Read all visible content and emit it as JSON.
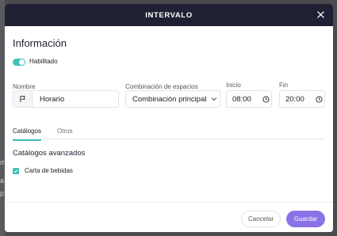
{
  "modal": {
    "title": "INTERVALO",
    "close_icon": "close-icon"
  },
  "info": {
    "title": "Información",
    "enabled_label": "Habilitado",
    "enabled": true
  },
  "fields": {
    "name": {
      "label": "Nombre",
      "value": "Horario",
      "icon": "flag-icon"
    },
    "combination": {
      "label": "Combinación de espacios",
      "value": "Combinación principal",
      "icon": "chevron-down-icon"
    },
    "start": {
      "label": "Inicio",
      "value": "08:00",
      "icon": "clock-icon"
    },
    "end": {
      "label": "Fin",
      "value": "20:00",
      "icon": "clock-icon"
    }
  },
  "tabs": [
    {
      "label": "Catálogos",
      "active": true
    },
    {
      "label": "Otros",
      "active": false
    }
  ],
  "catalogs": {
    "title": "Catálogos avanzados",
    "items": [
      {
        "label": "Carta de bebidas",
        "checked": true
      }
    ]
  },
  "footer": {
    "cancel_label": "Cancelar",
    "save_label": "Guardar"
  },
  "background": {
    "letters": [
      "m",
      "a",
      "p"
    ]
  },
  "colors": {
    "header_bg": "#1f2033",
    "accent_teal": "#3fc2b6",
    "primary_button": "#8a72e6"
  }
}
